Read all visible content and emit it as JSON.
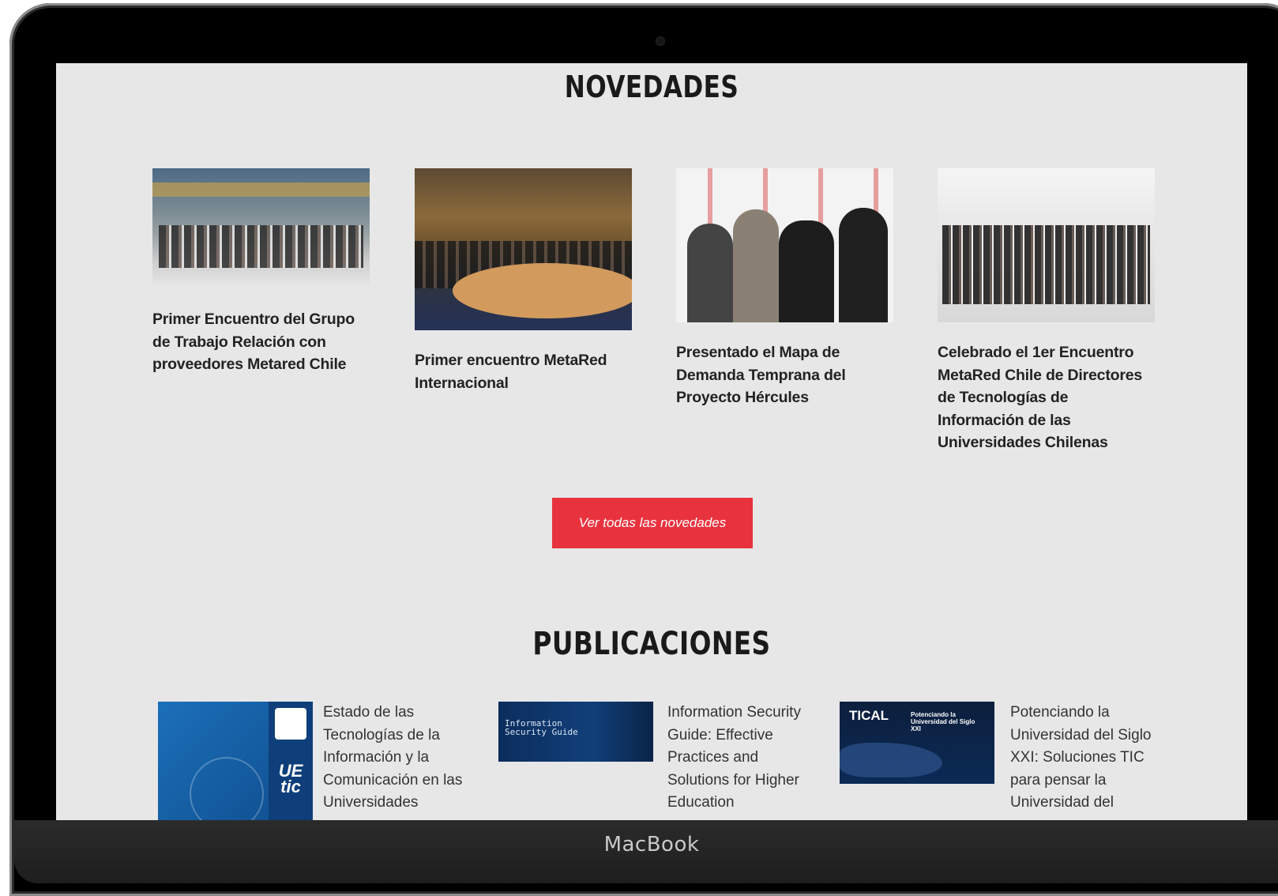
{
  "device": {
    "brand_label": "MacBook"
  },
  "novedades": {
    "title": "NOVEDADES",
    "items": [
      {
        "caption": "Primer Encuentro del Grupo de Trabajo Relación con proveedores Metared Chile"
      },
      {
        "caption": "Primer encuentro MetaRed Internacional"
      },
      {
        "caption": "Presentado el Mapa de Demanda Temprana del Proyecto Hércules"
      },
      {
        "caption": "Celebrado el 1er Encuentro MetaRed Chile de Directores de Tecnologías de Información de las Universidades Chilenas"
      }
    ],
    "button_label": "Ver todas las novedades"
  },
  "publicaciones": {
    "title": "PUBLICACIONES",
    "items": [
      {
        "text": "Estado de las Tecnologías de la Información y la Comunicación en las Universidades",
        "thumb_text": "UE tic"
      },
      {
        "text": "Information Security Guide: Effective Practices and Solutions for Higher Education",
        "thumb_text": "Information Security Guide"
      },
      {
        "text": "Potenciando la Universidad del Siglo XXI: Soluciones TIC para pensar la Universidad del",
        "thumb_text": "TICAL",
        "thumb_subtitle": "Potenciando la Universidad del Siglo XXI"
      }
    ]
  },
  "colors": {
    "accent": "#e8333f",
    "screen_bg": "#e7e7e7"
  }
}
